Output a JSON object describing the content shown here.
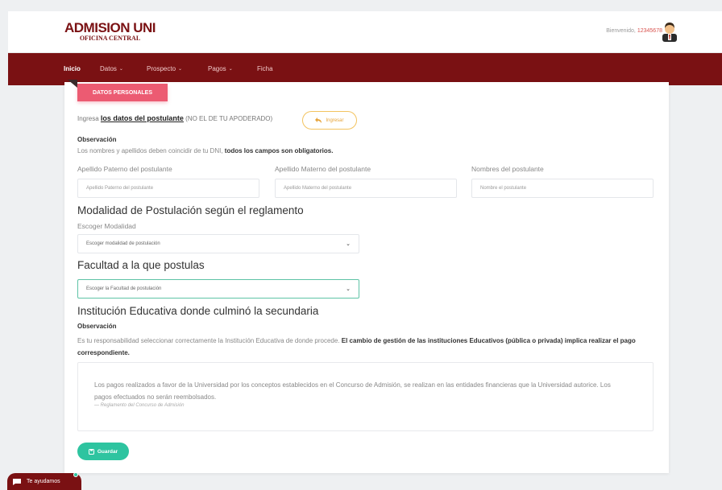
{
  "header": {
    "logo_line1": "ADMISION UNI",
    "logo_line2": "OFICINA CENTRAL",
    "welcome_label": "Bienvenido,",
    "user_code": "12345678"
  },
  "nav": {
    "items": [
      {
        "label": "Inicio",
        "active": true,
        "dropdown": false
      },
      {
        "label": "Datos",
        "active": false,
        "dropdown": true
      },
      {
        "label": "Prospecto",
        "active": false,
        "dropdown": true
      },
      {
        "label": "Pagos",
        "active": false,
        "dropdown": true
      },
      {
        "label": "Ficha",
        "active": false,
        "dropdown": false
      }
    ]
  },
  "form": {
    "ribbon": "DATOS PERSONALES",
    "ingresa_prefix": "Ingresa",
    "ingresa_strong": "los datos del postulante",
    "ingresa_suffix": "(NO EL DE TU APODERADO)",
    "ingresar_button": "Ingresar",
    "obs1_title": "Observación",
    "obs1_text": "Los nombres y apellidos deben coincidir de tu DNI,",
    "obs1_bold": "todos los campos son obligatorios.",
    "fields": [
      {
        "label": "Apellido Paterno del postulante",
        "placeholder": "Apellido Paterno del postulante"
      },
      {
        "label": "Apellido Materno del postulante",
        "placeholder": "Apellido Materno del postulante"
      },
      {
        "label": "Nombres del postulante",
        "placeholder": "Nombre el postulante"
      }
    ],
    "modalidad_title": "Modalidad de Postulación según el reglamento",
    "modalidad_label": "Escoger Modalidad",
    "modalidad_select": "Escoger modalidad de postulación",
    "facultad_title": "Facultad a la que postulas",
    "facultad_select": "Escoger la Facultad de postulación",
    "institucion_title": "Institución Educativa donde culminó la secundaria",
    "obs2_title": "Observación",
    "obs2_text": "Es tu responsabilidad seleccionar correctamente la Institución Educativa de donde procede.",
    "obs2_bold": "El cambio de gestión de las instituciones Educativos (pública o privada) implica realizar el pago correspondiente.",
    "quote_text": "Los pagos realizados a favor de la Universidad por los conceptos establecidos en el Concurso de Admisión, se realizan en las entidades financieras que la Universidad autorice. Los pagos efectuados no serán reembolsados.",
    "quote_cite": "— Reglamento del Concurso de Admisión",
    "save_button": "Guardar"
  },
  "help": {
    "label": "Te ayudamos"
  },
  "colors": {
    "brand": "#7a1113",
    "ribbon": "#ec5b72",
    "accent_green": "#2ec4a0",
    "accent_yellow": "#f3c35f"
  }
}
